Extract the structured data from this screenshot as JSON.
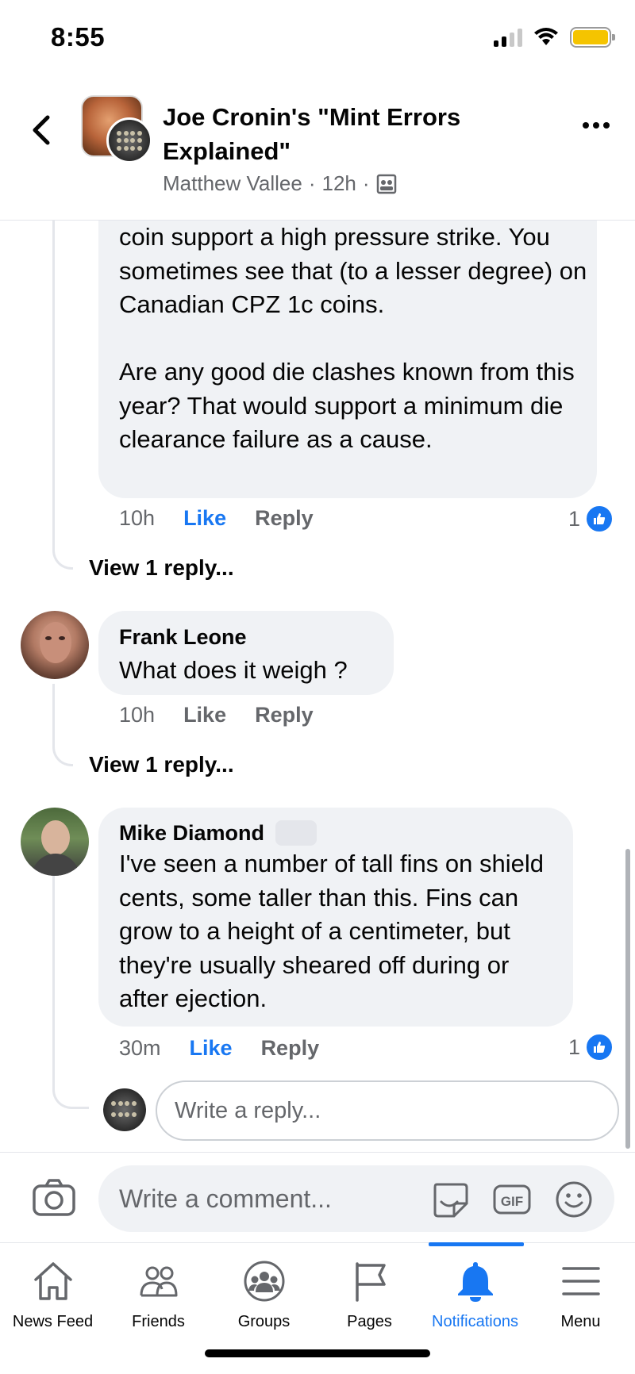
{
  "status": {
    "time": "8:55"
  },
  "header": {
    "group_title": "Joe Cronin's \"Mint Errors Explained\"",
    "author": "Matthew Vallee",
    "time": "12h"
  },
  "comments": {
    "first": {
      "text": "coin support a high pressure strike. You sometimes see that (to a lesser degree) on Canadian CPZ 1c coins.\n\nAre any good die clashes known from this year? That would support a minimum die clearance failure as a cause.",
      "time": "10h",
      "like_label": "Like",
      "reply_label": "Reply",
      "reaction_count": "1",
      "view_replies": "View 1 reply..."
    },
    "frank": {
      "author": "Frank Leone",
      "text": "What does it weigh ?",
      "time": "10h",
      "like_label": "Like",
      "reply_label": "Reply",
      "view_replies": "View 1 reply..."
    },
    "mike": {
      "author": "Mike Diamond",
      "text": "I've seen a number of tall fins on shield cents, some taller than this. Fins can grow to a height of a centimeter, but they're usually sheared off during or after ejection.",
      "time": "30m",
      "like_label": "Like",
      "reply_label": "Reply",
      "reaction_count": "1"
    }
  },
  "reply_box": {
    "placeholder": "Write a reply..."
  },
  "composer": {
    "placeholder": "Write a comment...",
    "gif_label": "GIF"
  },
  "tabs": [
    {
      "label": "News Feed",
      "icon": "home-icon"
    },
    {
      "label": "Friends",
      "icon": "friends-icon"
    },
    {
      "label": "Groups",
      "icon": "groups-icon"
    },
    {
      "label": "Pages",
      "icon": "flag-icon"
    },
    {
      "label": "Notifications",
      "icon": "bell-icon",
      "active": true
    },
    {
      "label": "Menu",
      "icon": "menu-icon"
    }
  ],
  "colors": {
    "accent": "#1877f2",
    "bubble": "#f0f2f5",
    "secondary_text": "#65676b"
  }
}
